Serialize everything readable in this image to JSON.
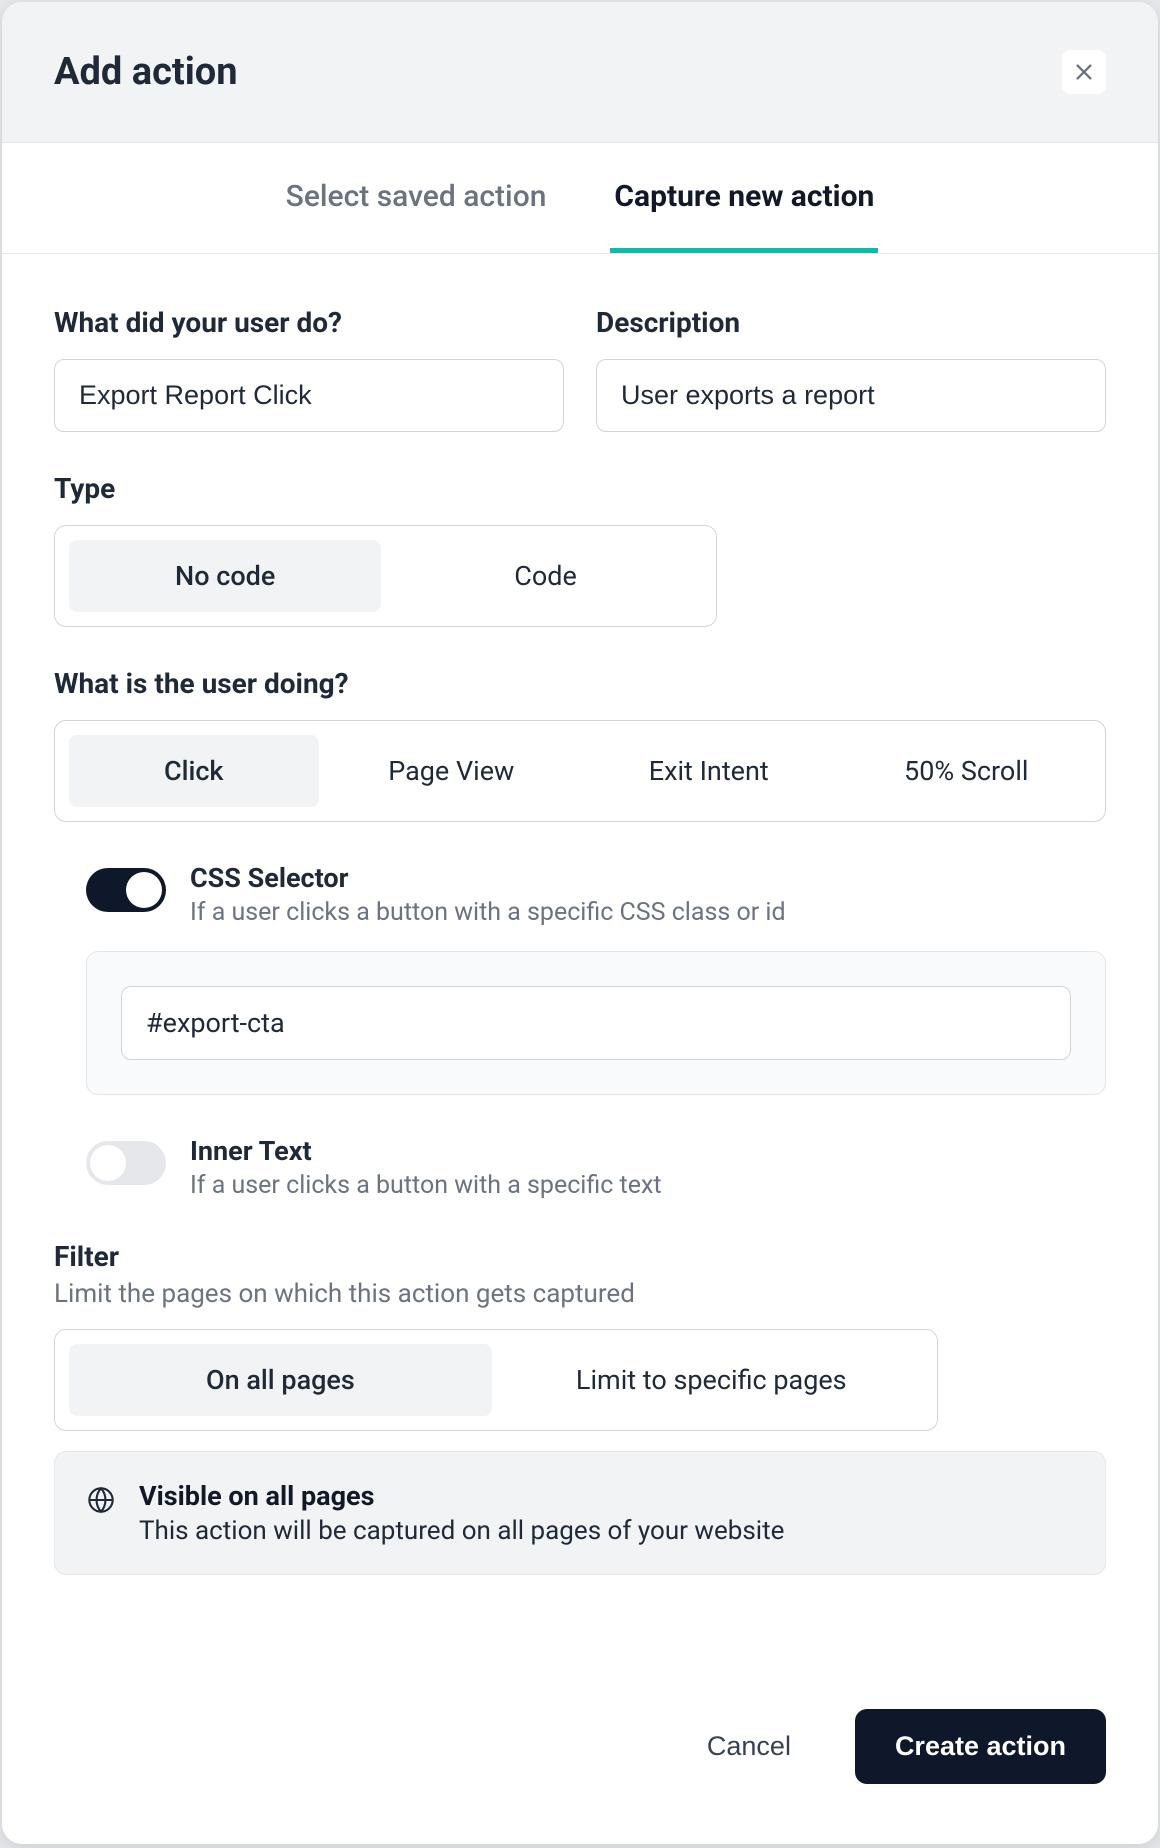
{
  "modal": {
    "title": "Add action"
  },
  "tabs": {
    "saved": "Select saved action",
    "capture": "Capture new action"
  },
  "fields": {
    "what_did_label": "What did your user do?",
    "what_did_value": "Export Report Click",
    "desc_label": "Description",
    "desc_value": "User exports a report"
  },
  "type": {
    "label": "Type",
    "no_code": "No code",
    "code": "Code"
  },
  "doing": {
    "label": "What is the user doing?",
    "click": "Click",
    "page_view": "Page View",
    "exit_intent": "Exit Intent",
    "scroll_50": "50% Scroll"
  },
  "css": {
    "title": "CSS Selector",
    "desc": "If a user clicks a button with a specific CSS class or id",
    "value": "#export-cta"
  },
  "inner_text": {
    "title": "Inner Text",
    "desc": "If a user clicks a button with a specific text"
  },
  "filter": {
    "label": "Filter",
    "sublabel": "Limit the pages on which this action gets captured",
    "all_pages": "On all pages",
    "limit": "Limit to specific pages"
  },
  "info": {
    "title": "Visible on all pages",
    "desc": "This action will be captured on all pages of your website"
  },
  "footer": {
    "cancel": "Cancel",
    "create": "Create action"
  }
}
